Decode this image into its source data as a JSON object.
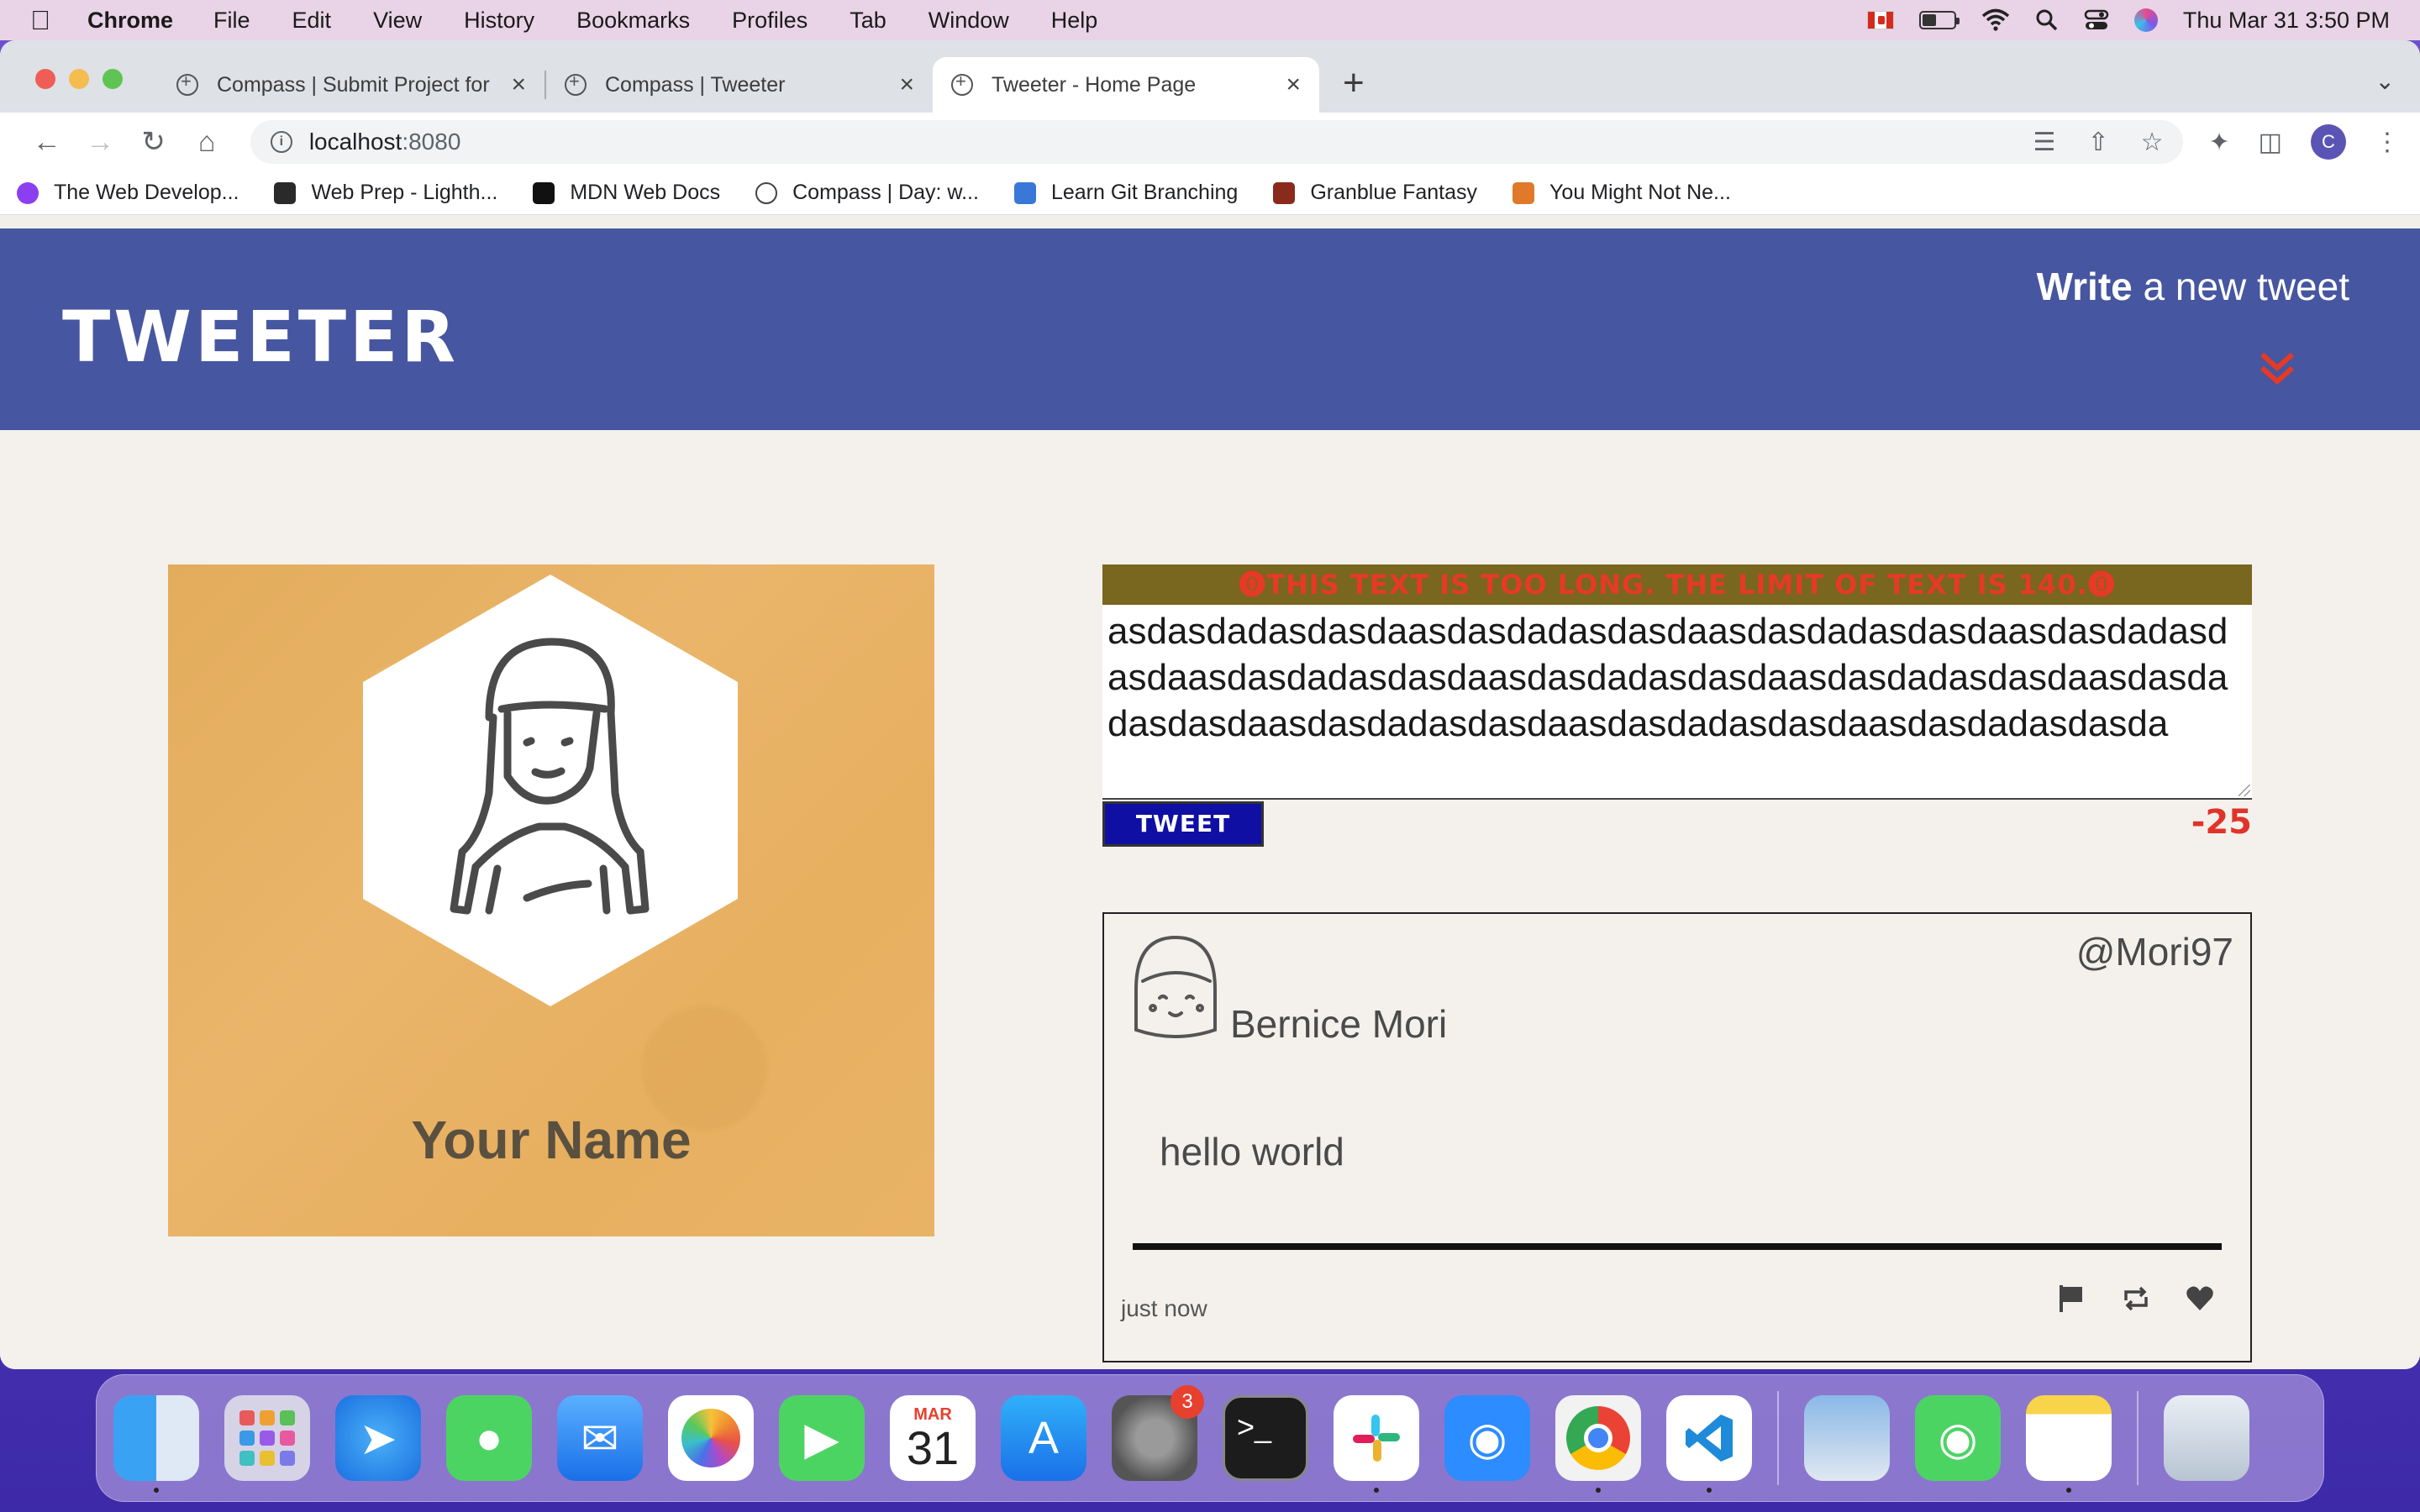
{
  "menubar": {
    "app": "Chrome",
    "items": [
      "File",
      "Edit",
      "View",
      "History",
      "Bookmarks",
      "Profiles",
      "Tab",
      "Window",
      "Help"
    ],
    "clock": "Thu Mar 31  3:50 PM"
  },
  "tabs": [
    {
      "title": "Compass | Submit Project for E",
      "active": false
    },
    {
      "title": "Compass | Tweeter",
      "active": false
    },
    {
      "title": "Tweeter - Home Page",
      "active": true
    }
  ],
  "address": {
    "host": "localhost",
    "port": ":8080"
  },
  "bookmarks": [
    {
      "label": "The Web Develop...",
      "color": "#8c3ff0"
    },
    {
      "label": "Web Prep - Lighth...",
      "color": "#2a2a2a"
    },
    {
      "label": "MDN Web Docs",
      "color": "#111111"
    },
    {
      "label": "Compass | Day: w...",
      "color": "#ffffff"
    },
    {
      "label": "Learn Git Branching",
      "color": "#3a78d8"
    },
    {
      "label": "Granblue Fantasy",
      "color": "#8a2a1a"
    },
    {
      "label": "You Might Not Ne...",
      "color": "#e07a2a"
    }
  ],
  "nav": {
    "logo": "TWEETER",
    "write_bold": "Write",
    "write_rest": " a new tweet"
  },
  "profile": {
    "name": "Your Name"
  },
  "composer": {
    "error": "⓿THIS TEXT IS TOO LONG. THE LIMIT OF TEXT IS 140.⓿",
    "text": "asdasdadasdasdaasdasdadasdasdaasdasdadasdasdaasdasdadasdasdaasdasdadasdasdaasdasdadasdasdaasdasdadasdasdaasdasdadasdasdaasdasdadasdasdaasdasdadasdasdaasdasdadasdasda",
    "button": "TWEET",
    "counter": "-25"
  },
  "tweet": {
    "name": "Bernice Mori",
    "handle": "@Mori97",
    "content": "hello world",
    "time": "just now"
  },
  "dock": {
    "settings_badge": "3",
    "calendar_month": "MAR",
    "calendar_day": "31"
  }
}
